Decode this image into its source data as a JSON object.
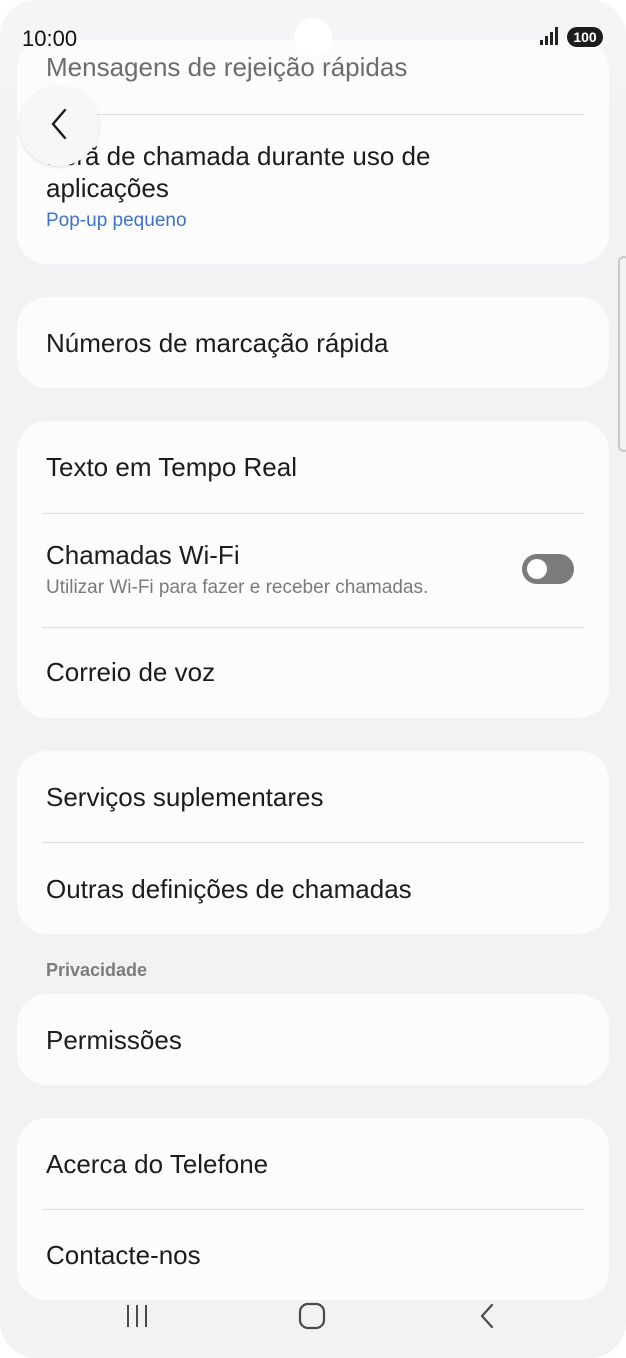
{
  "status_bar": {
    "time": "10:00",
    "battery": "100"
  },
  "header": {
    "faded_title": "Mensagens de rejeição rápidas"
  },
  "cards": {
    "call_display": {
      "title": "Ecrã de chamada durante uso de aplicações",
      "subtitle": "Pop-up pequeno"
    },
    "speed_dial": {
      "title": "Números de marcação rápida"
    },
    "group_three": {
      "rtt": {
        "title": "Texto em Tempo Real"
      },
      "wifi_calling": {
        "title": "Chamadas Wi-Fi",
        "subtitle": "Utilizar Wi-Fi para fazer e receber chamadas.",
        "enabled": false
      },
      "voicemail": {
        "title": "Correio de voz"
      }
    },
    "group_four": {
      "supplementary": {
        "title": "Serviços suplementares"
      },
      "other_settings": {
        "title": "Outras definições de chamadas"
      }
    },
    "privacy_section": {
      "label": "Privacidade"
    },
    "permissions": {
      "title": "Permissões"
    },
    "group_six": {
      "about": {
        "title": "Acerca do Telefone"
      },
      "contact": {
        "title": "Contacte-nos"
      }
    }
  },
  "icons": {
    "back": "chevron-left-icon",
    "recent_apps": "recent-apps-icon",
    "home": "home-icon",
    "nav_back": "nav-back-icon"
  },
  "colors": {
    "background": "#f2f2f4",
    "card": "#fcfcfc",
    "accent_blue": "#3e72c9",
    "toggle_off": "#7b7b7b"
  }
}
